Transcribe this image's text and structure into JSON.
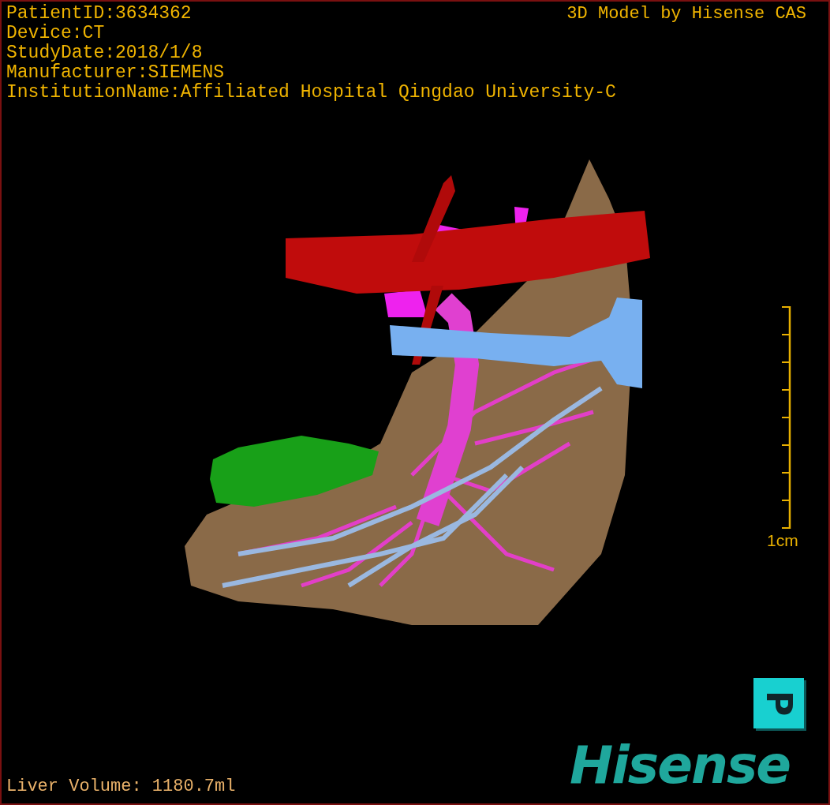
{
  "info_lines": [
    "PatientID:3634362",
    "Device:CT",
    "StudyDate:2018/1/8",
    "Manufacturer:SIEMENS",
    "InstitutionName:Affiliated Hospital Qingdao University-C"
  ],
  "model_caption": "3D Model by Hisense CAS",
  "scale_bar": {
    "label": "1cm"
  },
  "liver_volume": "Liver Volume: 1180.7ml",
  "orientation_cube": {
    "label": "P"
  },
  "logo": "Hisense"
}
